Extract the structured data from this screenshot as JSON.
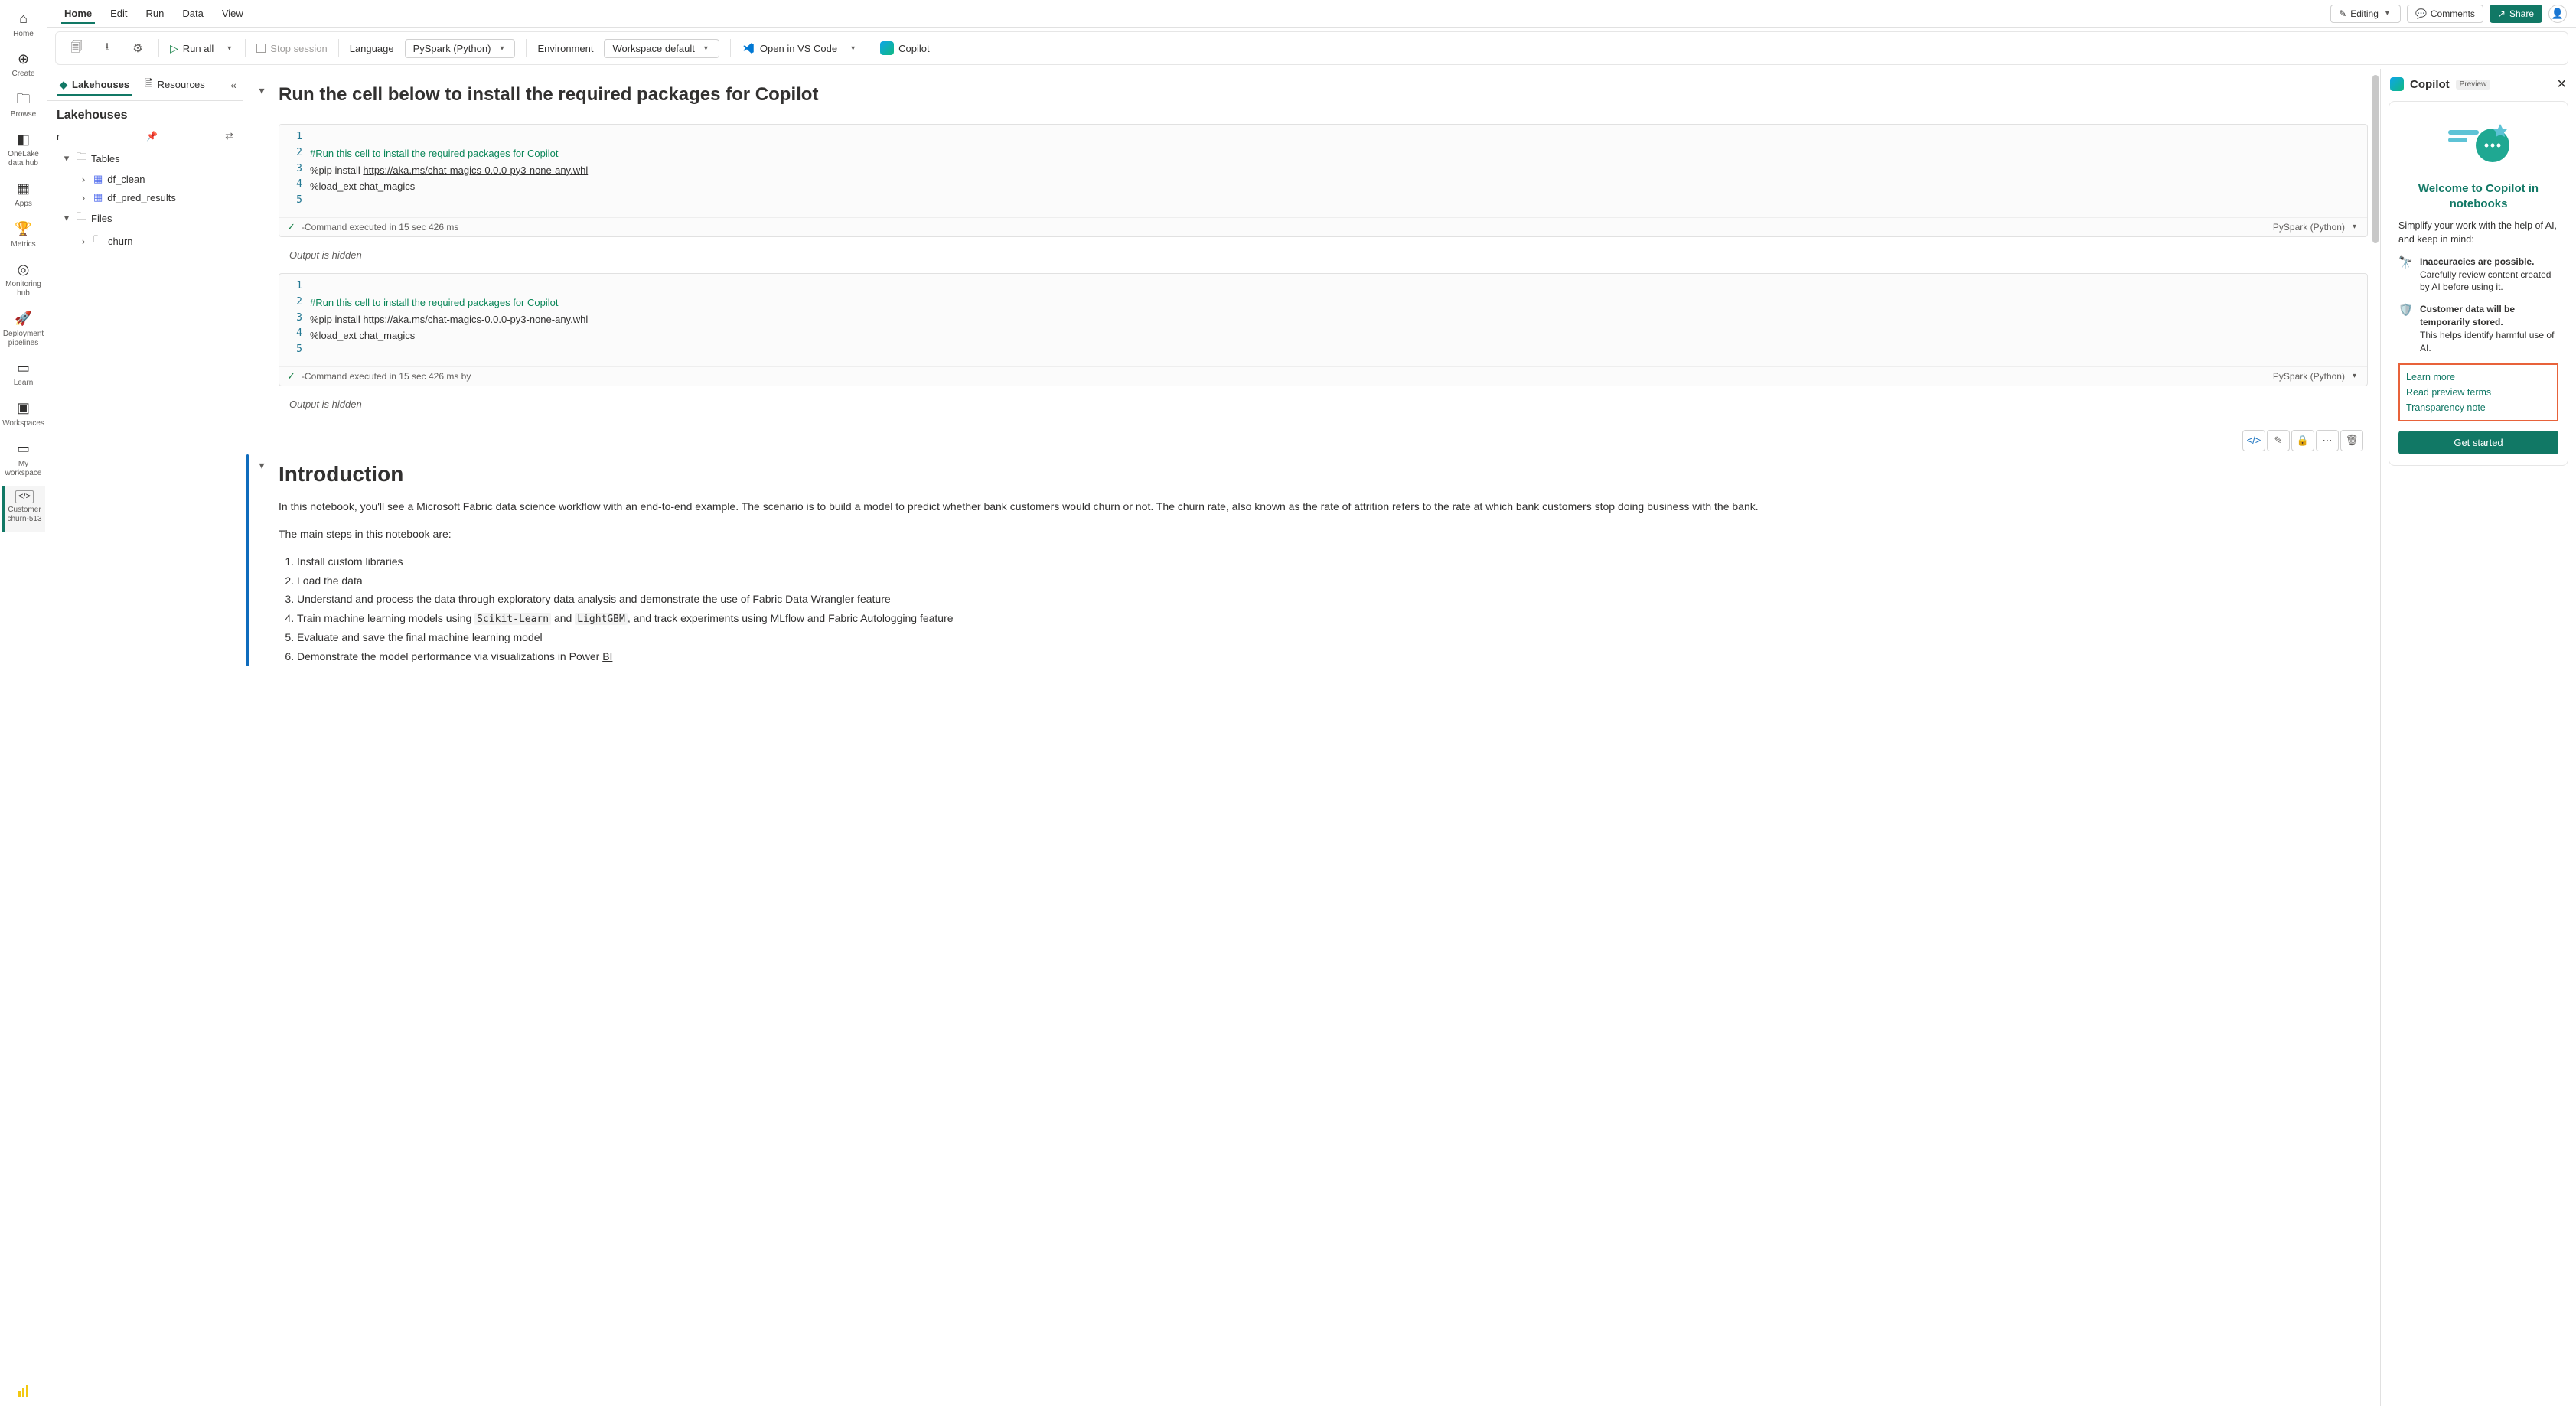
{
  "rail": {
    "items": [
      {
        "icon": "⌂",
        "label": "Home"
      },
      {
        "icon": "⊕",
        "label": "Create"
      },
      {
        "icon": "🗀",
        "label": "Browse"
      },
      {
        "icon": "◧",
        "label": "OneLake data hub"
      },
      {
        "icon": "▦",
        "label": "Apps"
      },
      {
        "icon": "🏆",
        "label": "Metrics"
      },
      {
        "icon": "◎",
        "label": "Monitoring hub"
      },
      {
        "icon": "🚀",
        "label": "Deployment pipelines"
      },
      {
        "icon": "▭",
        "label": "Learn"
      },
      {
        "icon": "▣",
        "label": "Workspaces"
      },
      {
        "icon": "",
        "label": "My workspace"
      }
    ],
    "active": {
      "icon": "</>",
      "label": "Customer churn-513"
    }
  },
  "ribbon": {
    "tabs": [
      "Home",
      "Edit",
      "Run",
      "Data",
      "View"
    ],
    "editing": "Editing",
    "comments": "Comments",
    "share": "Share"
  },
  "toolbar": {
    "runAll": "Run all",
    "stop": "Stop session",
    "languageLabel": "Language",
    "language": "PySpark (Python)",
    "environmentLabel": "Environment",
    "environment": "Workspace default",
    "openVSCode": "Open in VS Code",
    "copilot": "Copilot"
  },
  "explorer": {
    "tabs": {
      "lakehouses": "Lakehouses",
      "resources": "Resources"
    },
    "title": "Lakehouses",
    "rowLabel": "r",
    "tree": {
      "tables": "Tables",
      "df_clean": "df_clean",
      "df_pred_results": "df_pred_results",
      "files": "Files",
      "churn": "churn"
    }
  },
  "notebook": {
    "md1Title": "Run the cell below to install the required packages for Copilot",
    "cell1": {
      "code": {
        "comment": "#Run this cell to install the required packages for Copilot",
        "pipPrefix": "%pip install ",
        "pipUrl": "https://aka.ms/chat-magics-0.0.0-py3-none-any.whl",
        "loadext": "%load_ext chat_magics"
      },
      "status": "-Command executed in 15 sec 426 ms",
      "lang": "PySpark (Python)",
      "output": "Output is hidden"
    },
    "cell2": {
      "status": "-Command executed in 15 sec 426 ms by",
      "lang": "PySpark (Python)",
      "output": "Output is hidden"
    },
    "intro": {
      "title": "Introduction",
      "p1": "In this notebook, you'll see a Microsoft Fabric data science workflow with an end-to-end example. The scenario is to build a model to predict whether bank customers would churn or not. The churn rate, also known as the rate of attrition refers to the rate at which bank customers stop doing business with the bank.",
      "p2": "The main steps in this notebook are:",
      "steps": [
        "Install custom libraries",
        "Load the data",
        "Understand and process the data through exploratory data analysis and demonstrate the use of Fabric Data Wrangler feature",
        "Train machine learning models using Scikit-Learn and LightGBM, and track experiments using MLflow and Fabric Autologging feature",
        "Evaluate and save the final machine learning model",
        "Demonstrate the model performance via visualizations in Power BI"
      ],
      "codeSK": "Scikit-Learn",
      "codeLGBM": "LightGBM",
      "codeBI": "BI"
    }
  },
  "copilot": {
    "title": "Copilot",
    "badge": "Preview",
    "welcome": "Welcome to Copilot in notebooks",
    "sub": "Simplify your work with the help of AI, and keep in mind:",
    "p1Title": "Inaccuracies are possible.",
    "p1Body": "Carefully review content created by AI before using it.",
    "p2Title": "Customer data will be temporarily stored.",
    "p2Body": "This helps identify harmful use of AI.",
    "link1": "Learn more",
    "link2": "Read preview terms",
    "link3": "Transparency note",
    "getStarted": "Get started"
  }
}
